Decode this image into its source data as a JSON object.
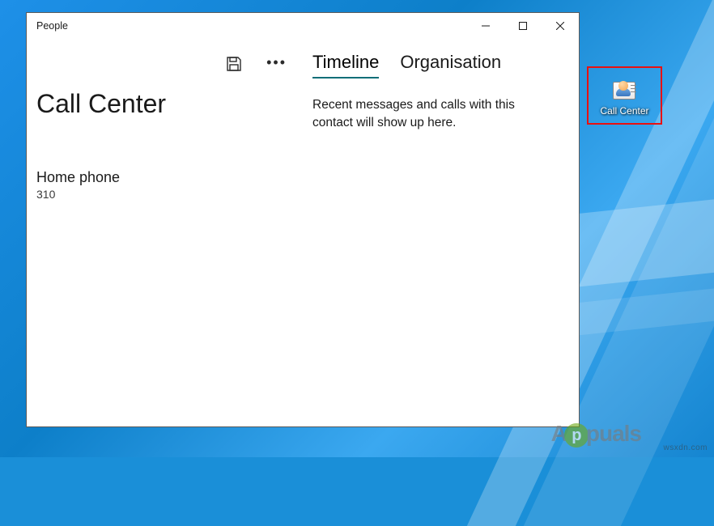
{
  "window": {
    "title": "People",
    "contact_name": "Call Center",
    "phone": {
      "label": "Home phone",
      "value": "310"
    },
    "tabs": {
      "timeline": "Timeline",
      "organisation": "Organisation"
    },
    "timeline_message": "Recent messages and calls with this contact will show up here."
  },
  "desktop_icon": {
    "label": "Call Center"
  },
  "watermark": "wsxdn.com",
  "brand": {
    "prefix": "A",
    "highlight": "p",
    "suffix": "puals"
  }
}
